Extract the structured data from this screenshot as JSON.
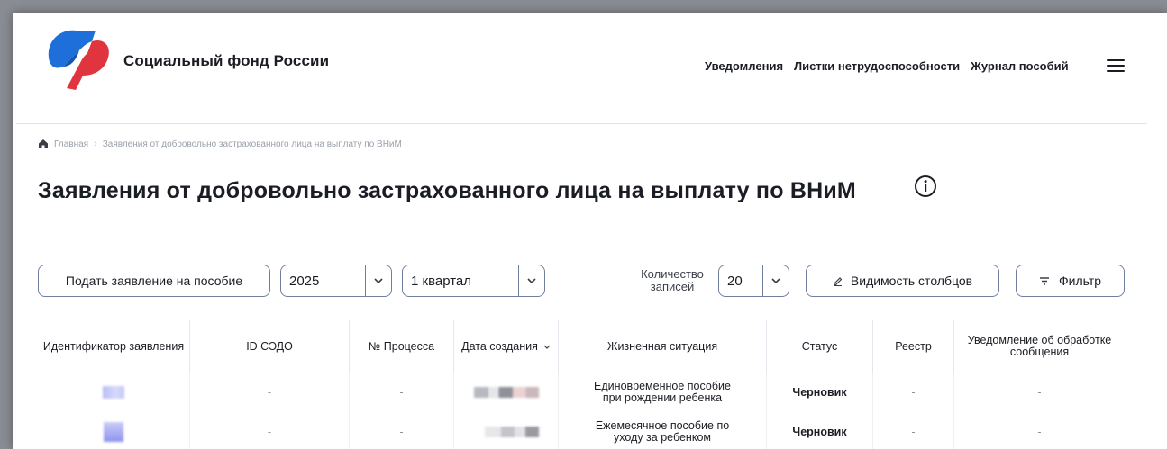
{
  "header": {
    "brand": "Социальный фонд России",
    "nav": [
      "Уведомления",
      "Листки нетрудоспособности",
      "Журнал пособий"
    ],
    "menu_icon": "hamburger-icon",
    "logo_colors": {
      "blue": "#1e6fd9",
      "red": "#e0353f"
    }
  },
  "breadcrumb": {
    "home_icon": "home-icon",
    "home": "Главная",
    "current": "Заявления от добровольно застрахованного лица на выплату по ВНиМ"
  },
  "page": {
    "title": "Заявления от добровольно застрахованного лица на выплату по ВНиМ",
    "info_icon": "info-circle-icon"
  },
  "controls": {
    "submit_button": "Подать заявление на пособие",
    "year": "2025",
    "quarter": "1 квартал",
    "records_label": "Количество записей",
    "records_value": "20",
    "visibility_button": "Видимость столбцов",
    "visibility_icon": "pencil-icon",
    "filter_button": "Фильтр",
    "filter_icon": "filter-icon"
  },
  "table": {
    "columns": [
      "Идентификатор заявления",
      "ID СЭДО",
      "№ Процесса",
      "Дата создания",
      "Жизненная ситуация",
      "Статус",
      "Реестр",
      "Уведомление об обработке сообщения"
    ],
    "sort_icon": "chevron-down-icon",
    "rows": [
      {
        "id_sedo": "-",
        "process": "-",
        "situation": "Единовременное пособие при рождении ребенка",
        "status": "Черновик",
        "registry": "-",
        "notice": "-"
      },
      {
        "id_sedo": "-",
        "process": "-",
        "situation": "Ежемесячное пособие по уходу за ребенком",
        "status": "Черновик",
        "registry": "-",
        "notice": "-"
      }
    ]
  }
}
